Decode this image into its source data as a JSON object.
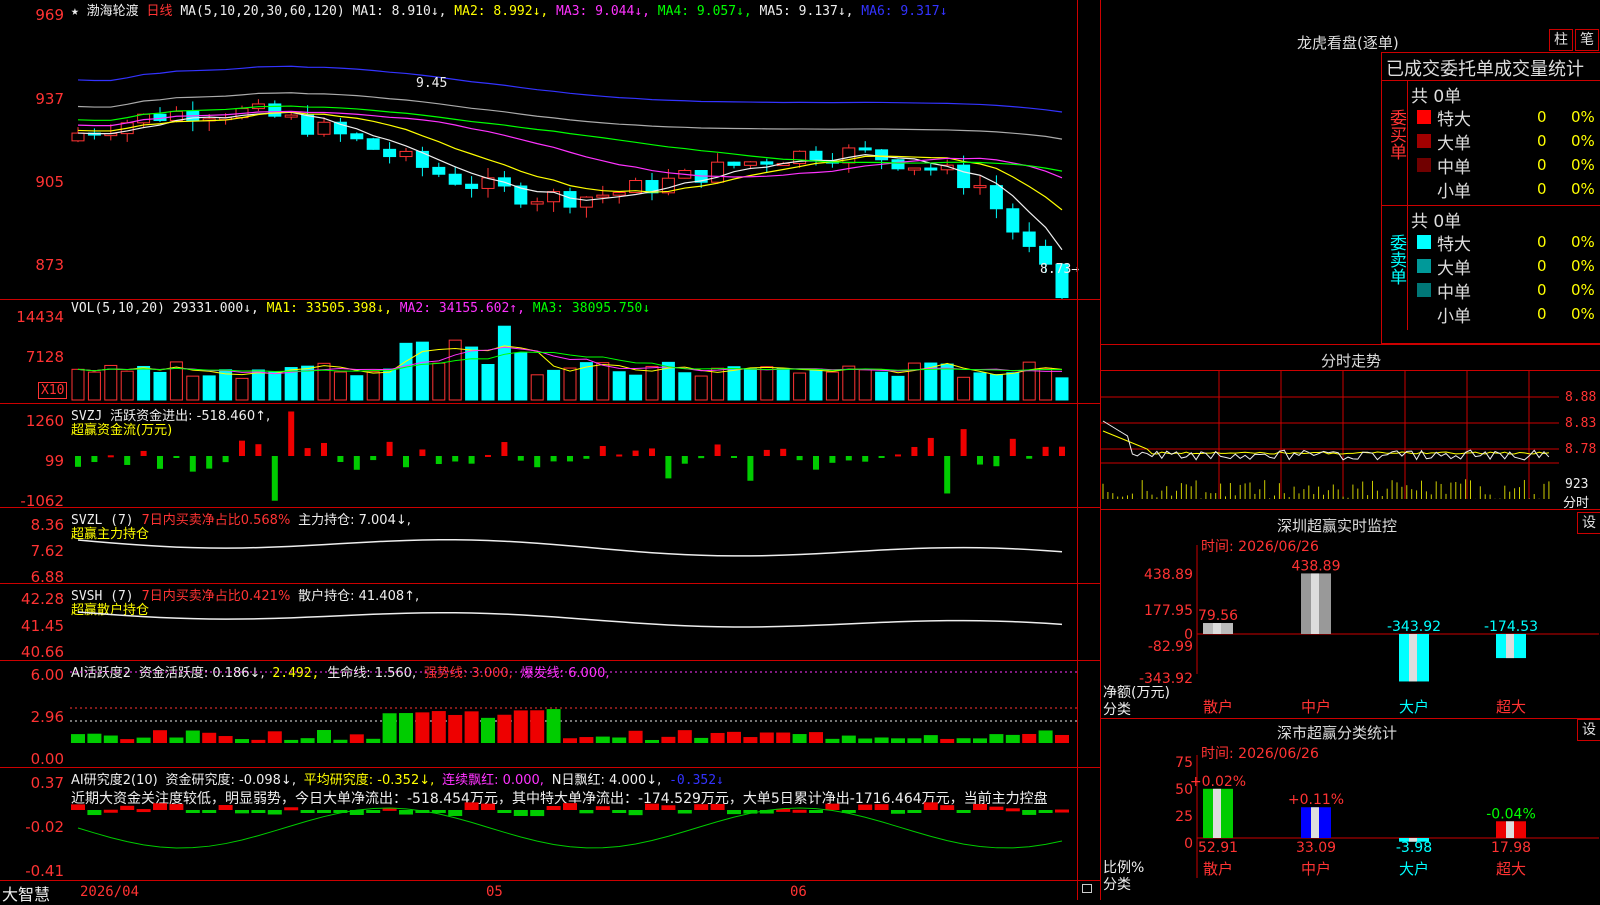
{
  "stock": {
    "name": "渤海轮渡",
    "period": "日线",
    "star": "★"
  },
  "price_panel": {
    "header": {
      "label": "MA(5,10,20,30,60,120)",
      "ma1": "MA1: 8.910↓,",
      "ma2": "MA2: 8.992↓,",
      "ma3": "MA3: 9.044↓,",
      "ma4": "MA4: 9.057↓,",
      "ma5": "MA5: 9.137↓,",
      "ma6": "MA6: 9.317↓"
    },
    "y_ticks": [
      "969",
      "937",
      "905",
      "873"
    ],
    "high_label": "9.45",
    "low_label": "8.73→"
  },
  "vol_panel": {
    "header": {
      "label": "VOL(5,10,20)",
      "vol": "29331.000↓,",
      "ma1": "MA1: 33505.398↓,",
      "ma2": "MA2: 34155.602↑,",
      "ma3": "MA3: 38095.750↓"
    },
    "y_ticks": [
      "14434",
      "7128"
    ],
    "unit": "X10"
  },
  "svzj_panel": {
    "header": {
      "label": "SVZJ",
      "text": "活跃资金进出: -518.460↑,"
    },
    "sub": "超赢资金流(万元)",
    "y_ticks": [
      "1260",
      "99",
      "-1062"
    ]
  },
  "svzl_panel": {
    "header": {
      "label": "SVZL (7)",
      "ratio": "7日内买卖净占比0.568%",
      "hold": "主力持仓: 7.004↓,"
    },
    "sub": "超赢主力持仓",
    "y_ticks": [
      "8.36",
      "7.62",
      "6.88"
    ]
  },
  "svsh_panel": {
    "header": {
      "label": "SVSH (7)",
      "ratio": "7日内买卖净占比0.421%",
      "hold": "散户持仓: 41.408↑,"
    },
    "sub": "超赢散户持仓",
    "y_ticks": [
      "42.28",
      "41.45",
      "40.66"
    ]
  },
  "ai_panel": {
    "header": {
      "label": "AI活跃度2",
      "act": "资金活跃度: 0.186↓,",
      "v2": "2.492,",
      "life": "生命线: 1.560,",
      "strong": "强势线: 3.000,",
      "burst": "爆发线: 6.000,"
    },
    "y_ticks": [
      "6.00",
      "2.96",
      "0.00"
    ]
  },
  "research_panel": {
    "header": {
      "label": "AI研究度2(10)",
      "r1": "资金研究度: -0.098↓,",
      "r2": "平均研究度: -0.352↓,",
      "r3": "连续飘红: 0.000,",
      "r4": "N日飘红: 4.000↓,",
      "r5": "-0.352↓"
    },
    "text": "近期大资金关注度较低，明显弱势，今日大单净流出：-518.454万元，其中特大单净流出：-174.529万元，大单5日累计净出-1716.464万元，当前主力控盘",
    "y_ticks": [
      "0.37",
      "-0.02",
      "-0.41"
    ]
  },
  "x_axis": {
    "brand": "大智慧",
    "labels": [
      "2026/04",
      "05",
      "06"
    ]
  },
  "dragon": {
    "title": "龙虎看盘(逐单)",
    "btn_bar": "柱",
    "btn_pen": "笔",
    "tabs": "已成交委托单成交量统计",
    "buy": {
      "side": "委买单",
      "total": "共 0单",
      "rows": [
        {
          "label": "特大",
          "v": "0",
          "p": "0%",
          "color": "#ff0000"
        },
        {
          "label": "大单",
          "v": "0",
          "p": "0%",
          "color": "#a00000"
        },
        {
          "label": "中单",
          "v": "0",
          "p": "0%",
          "color": "#700000"
        },
        {
          "label": "小单",
          "v": "0",
          "p": "0%",
          "color": "#000000"
        }
      ]
    },
    "sell": {
      "side": "委卖单",
      "total": "共 0单",
      "rows": [
        {
          "label": "特大",
          "v": "0",
          "p": "0%",
          "color": "#00ffff"
        },
        {
          "label": "大单",
          "v": "0",
          "p": "0%",
          "color": "#009999"
        },
        {
          "label": "中单",
          "v": "0",
          "p": "0%",
          "color": "#007777"
        },
        {
          "label": "小单",
          "v": "0",
          "p": "0%",
          "color": "#000000"
        }
      ]
    }
  },
  "intraday": {
    "title": "分时走势",
    "y_ticks": [
      "8.88",
      "8.83",
      "8.78"
    ],
    "vol_label": "923",
    "unit": "分时"
  },
  "monitor": {
    "title": "深圳超赢实时监控",
    "setting": "设",
    "time": "时间: 2026/06/26",
    "y_ticks": [
      "438.89",
      "177.95",
      "-82.99",
      "-343.92"
    ],
    "zero": "0",
    "ylabel": "净额(万元)",
    "xlabel": "分类",
    "chart_data": {
      "type": "bar",
      "categories": [
        "散户",
        "中户",
        "大户",
        "超大"
      ],
      "values": [
        79.56,
        438.89,
        -343.92,
        -174.53
      ],
      "value_labels": [
        "79.56",
        "438.89",
        "-343.92",
        "-174.53"
      ],
      "ylim": [
        -343.92,
        438.89
      ],
      "ylabel": "净额(万元)",
      "xlabel": "分类"
    }
  },
  "classify": {
    "title": "深市超赢分类统计",
    "setting": "设",
    "time": "时间: 2026/06/26",
    "y_ticks": [
      "75",
      "50",
      "25",
      "0"
    ],
    "ylabel": "比例%",
    "xlabel": "分类",
    "chart_data": {
      "type": "bar",
      "categories": [
        "散户",
        "中户",
        "大户",
        "超大"
      ],
      "values": [
        52.91,
        33.09,
        -3.98,
        17.98
      ],
      "value_labels": [
        "52.91",
        "33.09",
        "-3.98",
        "17.98"
      ],
      "changes": [
        "+0.02%",
        "+0.11%",
        "",
        "-0.04%"
      ],
      "ylim": [
        0,
        75
      ],
      "ylabel": "比例%",
      "xlabel": "分类"
    }
  },
  "colors": {
    "up": "#ff3333",
    "down": "#00ffff",
    "grid": "#cc0000",
    "green": "#00ff00"
  }
}
